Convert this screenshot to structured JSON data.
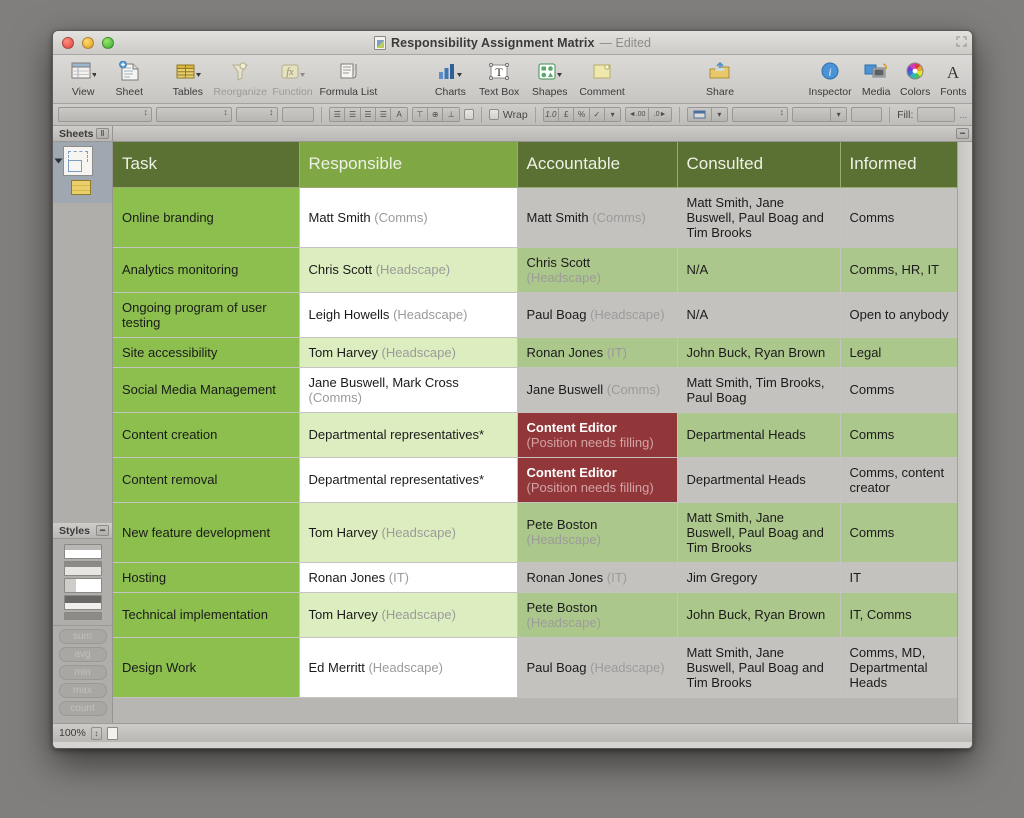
{
  "window": {
    "title": "Responsibility Assignment Matrix",
    "edited_suffix": "— Edited",
    "doc_icon": "numbers-document-icon"
  },
  "traffic_lights": {
    "close": "close-button",
    "minimize": "minimize-button",
    "zoom": "zoom-button"
  },
  "toolbar": {
    "items": [
      {
        "label": "View",
        "icon": "view-icon",
        "has_menu": true,
        "disabled": false
      },
      {
        "label": "Sheet",
        "icon": "new-sheet-icon",
        "has_menu": false,
        "disabled": false
      },
      {
        "label": "Tables",
        "icon": "tables-icon",
        "has_menu": true,
        "disabled": false
      },
      {
        "label": "Reorganize",
        "icon": "reorganize-icon",
        "has_menu": false,
        "disabled": true
      },
      {
        "label": "Function",
        "icon": "function-fx-icon",
        "has_menu": true,
        "disabled": true
      },
      {
        "label": "Formula List",
        "icon": "formula-list-icon",
        "has_menu": false,
        "disabled": false
      },
      {
        "label": "Charts",
        "icon": "charts-icon",
        "has_menu": true,
        "disabled": false
      },
      {
        "label": "Text Box",
        "icon": "text-box-icon",
        "has_menu": false,
        "disabled": false
      },
      {
        "label": "Shapes",
        "icon": "shapes-icon",
        "has_menu": true,
        "disabled": false
      },
      {
        "label": "Comment",
        "icon": "comment-icon",
        "has_menu": false,
        "disabled": false
      },
      {
        "label": "Share",
        "icon": "share-icon",
        "has_menu": false,
        "disabled": false
      },
      {
        "label": "Inspector",
        "icon": "inspector-info-icon",
        "has_menu": false,
        "disabled": false
      },
      {
        "label": "Media",
        "icon": "media-icon",
        "has_menu": false,
        "disabled": false
      },
      {
        "label": "Colors",
        "icon": "color-wheel-icon",
        "has_menu": false,
        "disabled": false
      },
      {
        "label": "Fonts",
        "icon": "fonts-icon",
        "has_menu": false,
        "disabled": false
      }
    ]
  },
  "format_bar": {
    "font_family": "",
    "font_style": "",
    "font_size": "",
    "text_color": "",
    "align_left": "align-left",
    "align_center": "align-center",
    "align_right": "align-right",
    "align_justify": "align-justify",
    "align_text": "align-text",
    "valign_top": "valign-top",
    "valign_middle": "valign-middle",
    "valign_bottom": "valign-bottom",
    "wrap_label": "Wrap",
    "wrap_checked": false,
    "num_decimal": "1.0",
    "num_currency": "£",
    "num_percent": "%",
    "num_check": "✓",
    "dec_decrease": "◄.00",
    "dec_increase": ".0►",
    "fill_label": "Fill:",
    "overflow": "..."
  },
  "sidebar": {
    "sheets_panel": {
      "title": "Sheets",
      "sheet_icon": "sheet-icon",
      "table_icon": "table-icon",
      "expanded": true
    },
    "styles_panel": {
      "title": "Styles",
      "functions": [
        "sum",
        "avg",
        "min",
        "max",
        "count"
      ]
    }
  },
  "status_bar": {
    "zoom": "100%",
    "stepper": "zoom-stepper",
    "page_icon": "page-view-icon"
  },
  "table": {
    "headers": [
      {
        "label": "Task",
        "selected": false
      },
      {
        "label": "Responsible",
        "selected": true
      },
      {
        "label": "Accountable",
        "selected": false
      },
      {
        "label": "Consulted",
        "selected": false
      },
      {
        "label": "Informed",
        "selected": false
      }
    ],
    "rows": [
      {
        "task": "Online branding",
        "responsible": {
          "name": "Matt Smith",
          "org": "(Comms)",
          "bg": "white"
        },
        "accountable": {
          "name": "Matt Smith",
          "org": "(Comms)",
          "bg": "gray"
        },
        "consulted": {
          "name": "Matt Smith, Jane Buswell, Paul Boag and Tim Brooks",
          "org": "",
          "bg": "gray"
        },
        "informed": {
          "name": "Comms",
          "org": "",
          "bg": "gray"
        }
      },
      {
        "task": "Analytics monitoring",
        "responsible": {
          "name": "Chris Scott",
          "org": "(Headscape)",
          "bg": "pale"
        },
        "accountable": {
          "name": "Chris Scott",
          "org": "(Headscape)",
          "bg": "sage"
        },
        "consulted": {
          "name": "N/A",
          "org": "",
          "bg": "sage"
        },
        "informed": {
          "name": "Comms, HR, IT",
          "org": "",
          "bg": "sage"
        }
      },
      {
        "task": "Ongoing program of user testing",
        "responsible": {
          "name": "Leigh Howells",
          "org": "(Headscape)",
          "bg": "white"
        },
        "accountable": {
          "name": "Paul Boag",
          "org": "(Headscape)",
          "bg": "gray"
        },
        "consulted": {
          "name": "N/A",
          "org": "",
          "bg": "gray"
        },
        "informed": {
          "name": "Open to anybody",
          "org": "",
          "bg": "gray"
        }
      },
      {
        "task": "Site accessibility",
        "responsible": {
          "name": "Tom Harvey",
          "org": "(Headscape)",
          "bg": "pale"
        },
        "accountable": {
          "name": "Ronan Jones",
          "org": "(IT)",
          "bg": "sage"
        },
        "consulted": {
          "name": "John Buck, Ryan Brown",
          "org": "",
          "bg": "sage"
        },
        "informed": {
          "name": "Legal",
          "org": "",
          "bg": "sage"
        }
      },
      {
        "task": "Social Media Management",
        "responsible": {
          "name": "Jane Buswell, Mark Cross",
          "org": "(Comms)",
          "bg": "white"
        },
        "accountable": {
          "name": "Jane Buswell",
          "org": "(Comms)",
          "bg": "gray"
        },
        "consulted": {
          "name": "Matt Smith, Tim Brooks, Paul Boag",
          "org": "",
          "bg": "gray"
        },
        "informed": {
          "name": "Comms",
          "org": "",
          "bg": "gray"
        }
      },
      {
        "task": "Content creation",
        "responsible": {
          "name": "Departmental representatives*",
          "org": "",
          "bg": "pale"
        },
        "accountable": {
          "name": "Content Editor",
          "org": "(Position needs filling)",
          "bg": "dkred"
        },
        "consulted": {
          "name": "Departmental Heads",
          "org": "",
          "bg": "sage"
        },
        "informed": {
          "name": "Comms",
          "org": "",
          "bg": "sage"
        }
      },
      {
        "task": "Content removal",
        "responsible": {
          "name": "Departmental representatives*",
          "org": "",
          "bg": "white"
        },
        "accountable": {
          "name": "Content Editor",
          "org": "(Position needs filling)",
          "bg": "dkred"
        },
        "consulted": {
          "name": "Departmental Heads",
          "org": "",
          "bg": "gray"
        },
        "informed": {
          "name": "Comms, content creator",
          "org": "",
          "bg": "gray"
        }
      },
      {
        "task": "New feature development",
        "responsible": {
          "name": "Tom Harvey",
          "org": "(Headscape)",
          "bg": "pale"
        },
        "accountable": {
          "name": "Pete Boston",
          "org": "(Headscape)",
          "bg": "sage"
        },
        "consulted": {
          "name": "Matt Smith, Jane Buswell, Paul Boag and Tim Brooks",
          "org": "",
          "bg": "sage"
        },
        "informed": {
          "name": "Comms",
          "org": "",
          "bg": "sage"
        }
      },
      {
        "task": "Hosting",
        "responsible": {
          "name": "Ronan Jones",
          "org": "(IT)",
          "bg": "white"
        },
        "accountable": {
          "name": "Ronan Jones",
          "org": "(IT)",
          "bg": "gray"
        },
        "consulted": {
          "name": "Jim Gregory",
          "org": "",
          "bg": "gray"
        },
        "informed": {
          "name": "IT",
          "org": "",
          "bg": "gray"
        }
      },
      {
        "task": "Technical implementation",
        "responsible": {
          "name": "Tom Harvey",
          "org": "(Headscape)",
          "bg": "pale"
        },
        "accountable": {
          "name": "Pete Boston",
          "org": "(Headscape)",
          "bg": "sage"
        },
        "consulted": {
          "name": "John Buck, Ryan Brown",
          "org": "",
          "bg": "sage"
        },
        "informed": {
          "name": "IT, Comms",
          "org": "",
          "bg": "sage"
        }
      },
      {
        "task": "Design Work",
        "responsible": {
          "name": "Ed Merritt",
          "org": "(Headscape)",
          "bg": "white"
        },
        "accountable": {
          "name": "Paul Boag",
          "org": "(Headscape)",
          "bg": "gray"
        },
        "consulted": {
          "name": "Matt Smith, Jane Buswell, Paul Boag and Tim Brooks",
          "org": "",
          "bg": "gray"
        },
        "informed": {
          "name": "Comms, MD, Departmental Heads",
          "org": "",
          "bg": "gray"
        }
      }
    ]
  },
  "colors": {
    "header_dark": "#5b7033",
    "header_selected": "#7fa845",
    "task_cell": "#8cbf4d",
    "pale_green": "#dcedc0",
    "sage_green": "#acc78b",
    "gray_cell": "#c4c2bf",
    "dark_red": "#91373a"
  }
}
